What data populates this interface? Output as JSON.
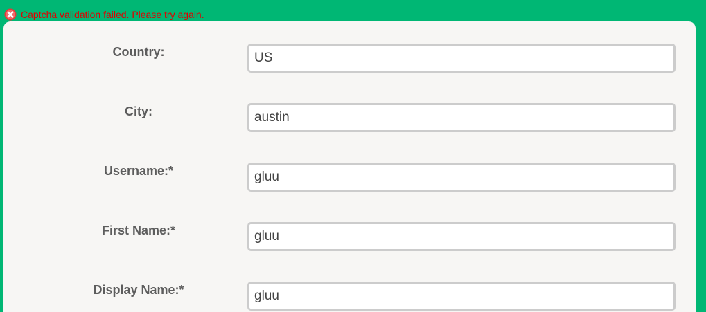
{
  "error": {
    "icon": "error-circle-x-icon",
    "message": "Captcha validation failed. Please try again."
  },
  "colors": {
    "background": "#00b774",
    "panel": "#f7f6f4",
    "error_text": "#e00000",
    "label_text": "#5d5d5d",
    "field_border": "#cccccc"
  },
  "form": {
    "fields": [
      {
        "label": "Country:",
        "value": "US"
      },
      {
        "label": "City:",
        "value": "austin"
      },
      {
        "label": "Username:*",
        "value": "gluu"
      },
      {
        "label": "First Name:*",
        "value": "gluu"
      },
      {
        "label": "Display Name:*",
        "value": "gluu"
      }
    ]
  }
}
